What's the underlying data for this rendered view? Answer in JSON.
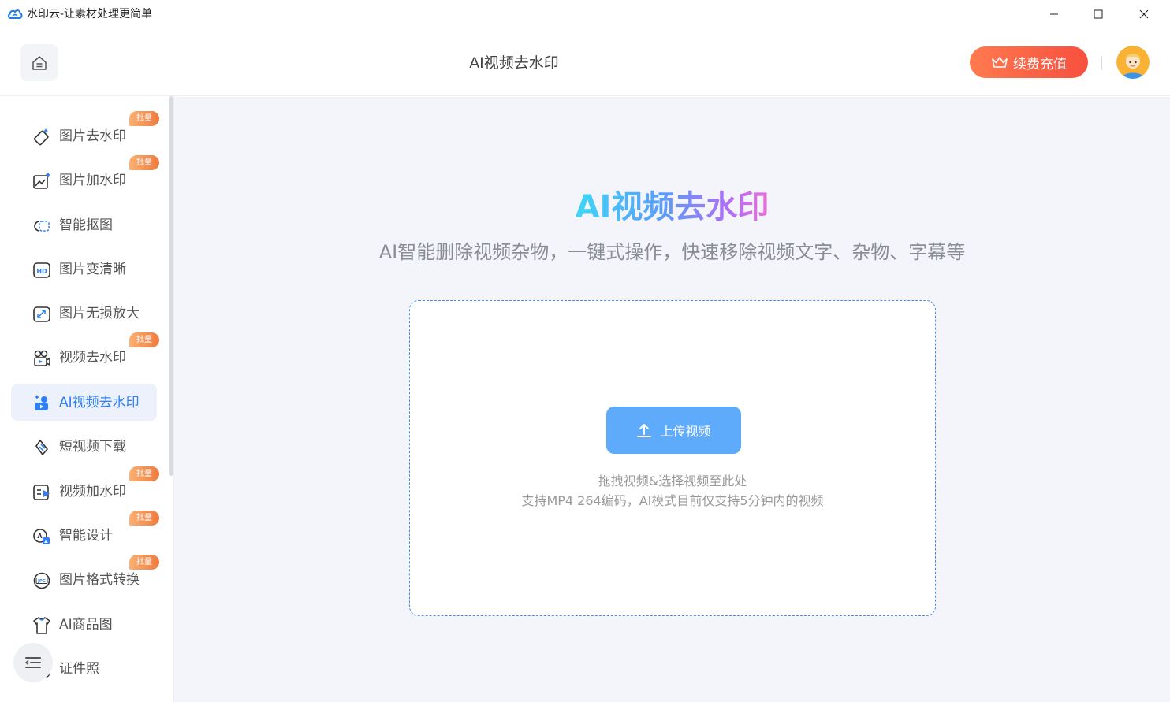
{
  "window": {
    "title": "水印云-让素材处理更简单"
  },
  "header": {
    "title": "AI视频去水印",
    "renew_label": "续费充值"
  },
  "sidebar": {
    "items": [
      {
        "label": "图片去水印",
        "icon": "eraser-icon",
        "badge": "批量"
      },
      {
        "label": "图片加水印",
        "icon": "image-add-icon",
        "badge": "批量"
      },
      {
        "label": "智能抠图",
        "icon": "cutout-icon",
        "badge": ""
      },
      {
        "label": "图片变清晰",
        "icon": "hd-icon",
        "badge": ""
      },
      {
        "label": "图片无损放大",
        "icon": "enlarge-icon",
        "badge": ""
      },
      {
        "label": "视频去水印",
        "icon": "video-eraser-icon",
        "badge": "批量"
      },
      {
        "label": "AI视频去水印",
        "icon": "ai-video-icon",
        "badge": "",
        "active": true
      },
      {
        "label": "短视频下载",
        "icon": "link-download-icon",
        "badge": ""
      },
      {
        "label": "视频加水印",
        "icon": "video-add-icon",
        "badge": "批量"
      },
      {
        "label": "智能设计",
        "icon": "design-icon",
        "badge": "批量"
      },
      {
        "label": "图片格式转换",
        "icon": "jpg-convert-icon",
        "badge": "批量"
      },
      {
        "label": "AI商品图",
        "icon": "shirt-icon",
        "badge": ""
      },
      {
        "label": "证件照",
        "icon": "id-photo-icon",
        "badge": ""
      }
    ]
  },
  "main": {
    "hero_title": "AI视频去水印",
    "hero_subtitle": "AI智能删除视频杂物，一键式操作，快速移除视频文字、杂物、字幕等",
    "upload_label": "上传视频",
    "hint_line1": "拖拽视频&选择视频至此处",
    "hint_line2": "支持MP4 264编码，AI模式目前仅支持5分钟内的视频"
  },
  "colors": {
    "accent": "#2f7ff5",
    "upload_button": "#5eaafb",
    "renew_button": "#f7503e",
    "badge": "#ef7a3e",
    "main_background": "#f3f5fa"
  }
}
